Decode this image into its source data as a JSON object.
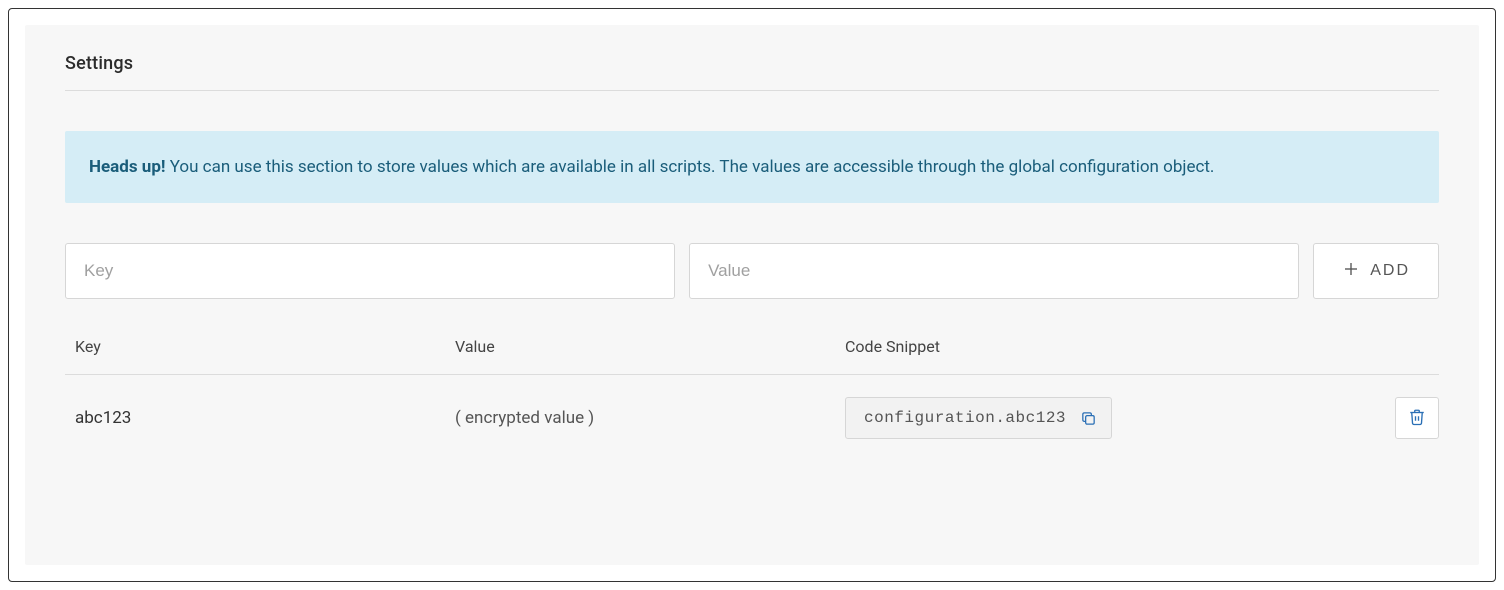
{
  "section": {
    "title": "Settings"
  },
  "banner": {
    "strong": "Heads up!",
    "text": " You can use this section to store values which are available in all scripts. The values are accessible through the global configuration object."
  },
  "inputs": {
    "key_placeholder": "Key",
    "value_placeholder": "Value",
    "add_label": "ADD"
  },
  "table": {
    "headers": {
      "key": "Key",
      "value": "Value",
      "snippet": "Code Snippet"
    },
    "rows": [
      {
        "key": "abc123",
        "value": "( encrypted value )",
        "snippet": "configuration.abc123"
      }
    ]
  }
}
